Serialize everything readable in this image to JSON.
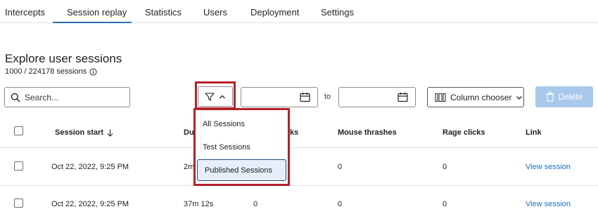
{
  "tabs": [
    {
      "label": "Intercepts"
    },
    {
      "label": "Session replay"
    },
    {
      "label": "Statistics"
    },
    {
      "label": "Users"
    },
    {
      "label": "Deployment"
    },
    {
      "label": "Settings"
    }
  ],
  "header": {
    "title": "Explore user sessions",
    "count": "1000 / 224178 sessions"
  },
  "toolbar": {
    "search_placeholder": "Search...",
    "to_label": "to",
    "column_chooser_label": "Column chooser",
    "delete_label": "Delete"
  },
  "table": {
    "columns": [
      "Session start",
      "Du",
      "ks",
      "Mouse thrashes",
      "Rage clicks",
      "Link"
    ],
    "rows": [
      {
        "session_start": "Oct 22, 2022, 9:25 PM",
        "duration": "2m",
        "clicks": "",
        "mouse_thrashes": "0",
        "rage_clicks": "0",
        "link": "View session"
      },
      {
        "session_start": "Oct 22, 2022, 9:25 PM",
        "duration": "37m 12s",
        "clicks": "0",
        "mouse_thrashes": "0",
        "rage_clicks": "0",
        "link": "View session"
      }
    ]
  },
  "filter_menu": {
    "items": [
      {
        "label": "All Sessions"
      },
      {
        "label": "Test Sessions"
      },
      {
        "label": "Published Sessions"
      }
    ],
    "selected": "Published Sessions"
  },
  "colors": {
    "accent": "#1d7fc9",
    "highlight": "#b4222b",
    "delete_disabled": "#a9c9ec",
    "link": "#1d6fc0"
  }
}
